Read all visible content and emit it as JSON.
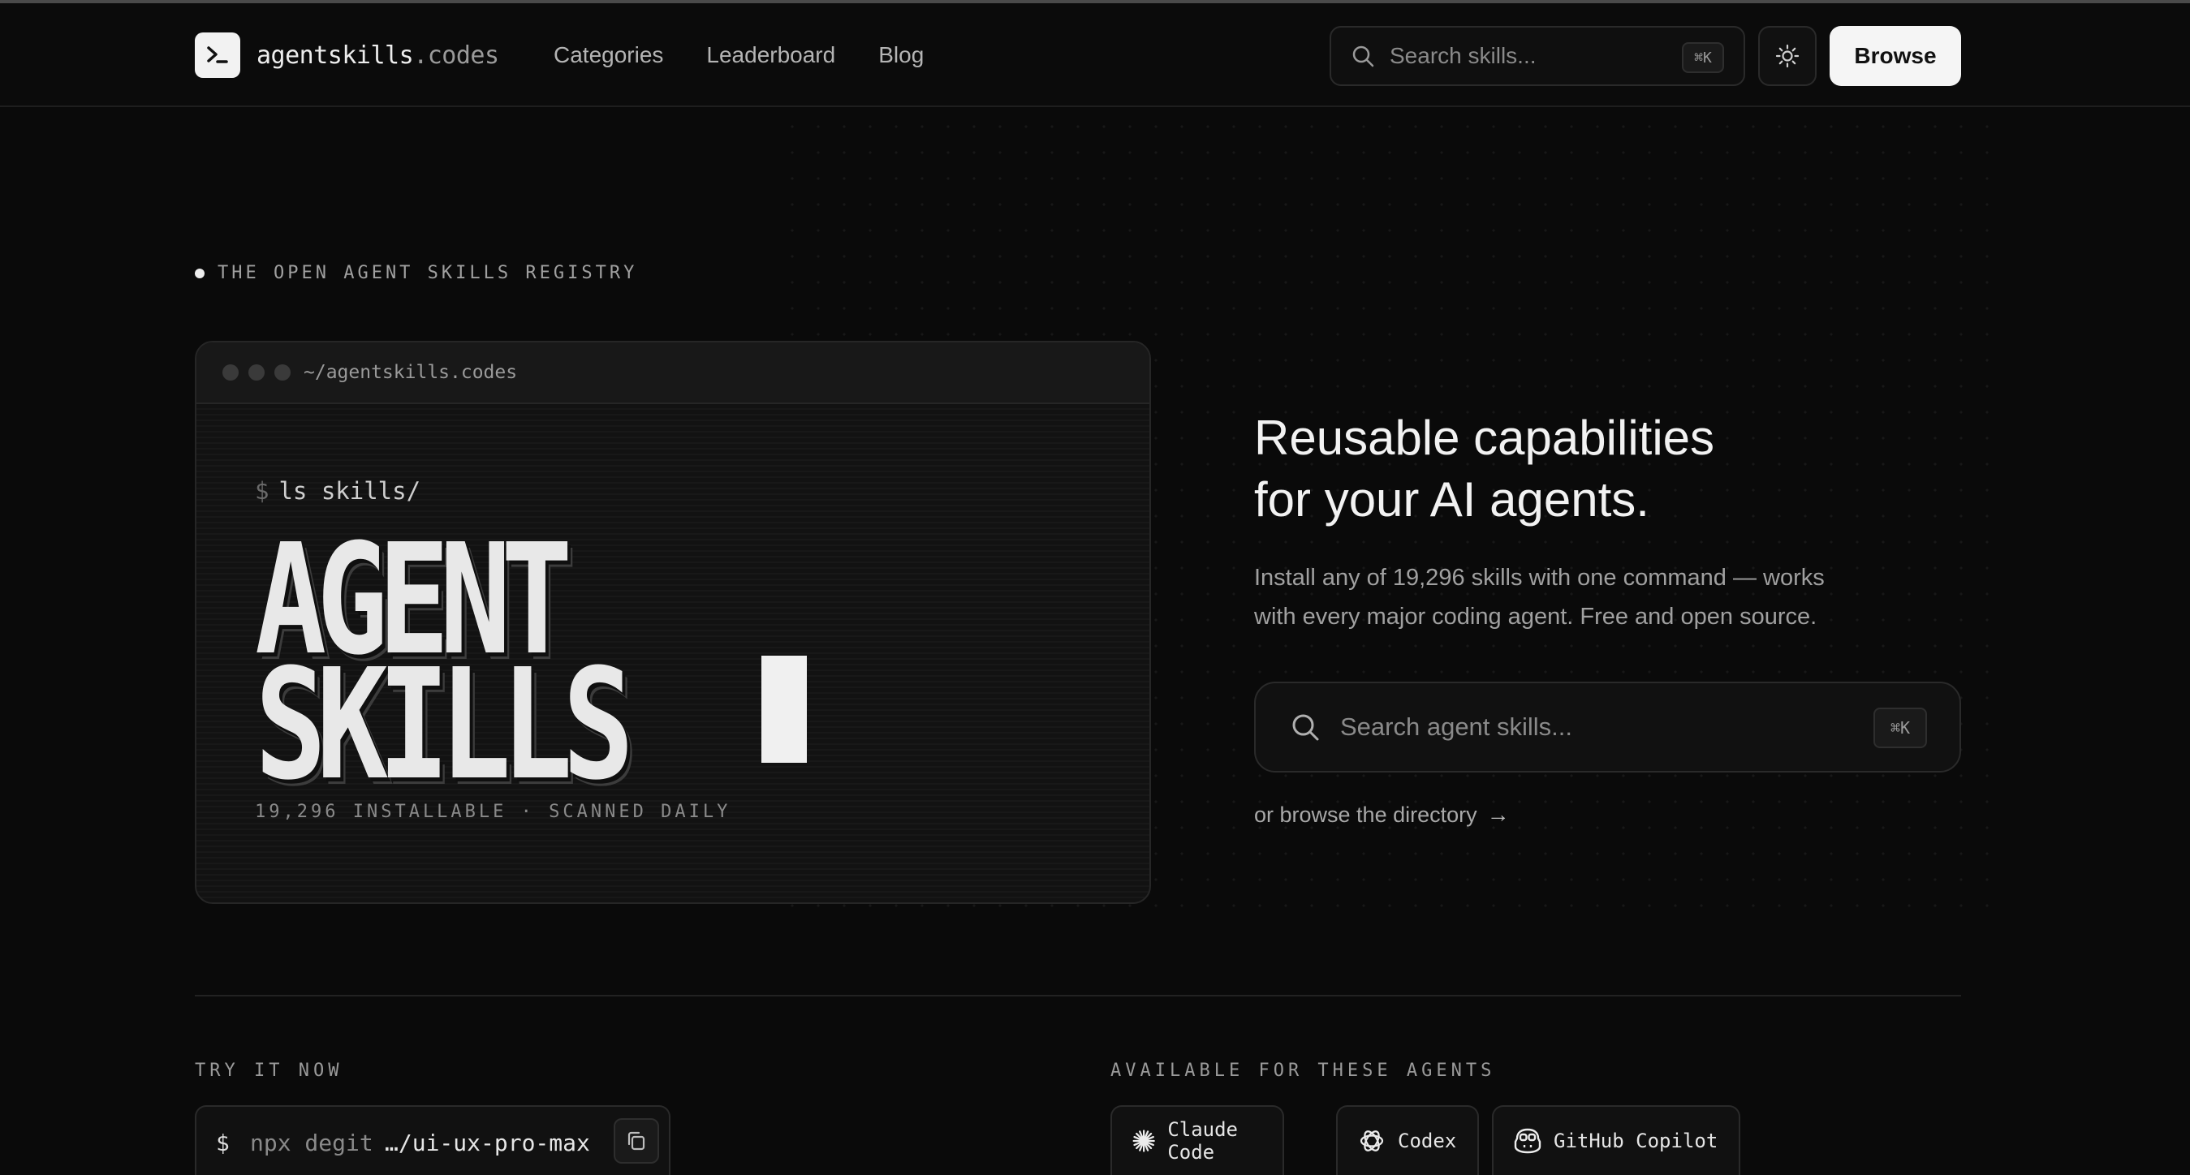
{
  "header": {
    "logo_text": "agentskills",
    "logo_suffix": ".codes",
    "nav": [
      "Categories",
      "Leaderboard",
      "Blog"
    ],
    "search_placeholder": "Search skills...",
    "search_shortcut": "⌘K",
    "browse_label": "Browse"
  },
  "hero": {
    "eyebrow": "THE OPEN AGENT SKILLS REGISTRY",
    "terminal": {
      "path": "~/agentskills.codes",
      "prompt_symbol": "$",
      "command": "ls skills/",
      "line1": "AGENT",
      "line2": "SKILLS",
      "stats": "19,296 INSTALLABLE · SCANNED DAILY"
    },
    "title_line1": "Reusable capabilities",
    "title_line2": "for your AI agents.",
    "subtitle_line1": "Install any of 19,296 skills with one command — works",
    "subtitle_line2": "with every major coding agent. Free and open source.",
    "search_placeholder": "Search agent skills...",
    "search_shortcut": "⌘K",
    "browse_link": "or browse the directory",
    "browse_arrow": "→"
  },
  "try_it": {
    "label": "TRY IT NOW",
    "prompt_symbol": "$",
    "command_prefix": "npx degit",
    "command_target": "…/ui-ux-pro-max"
  },
  "agents": {
    "label": "AVAILABLE FOR THESE AGENTS",
    "items": [
      "Claude Code",
      "Codex",
      "GitHub Copilot"
    ]
  }
}
